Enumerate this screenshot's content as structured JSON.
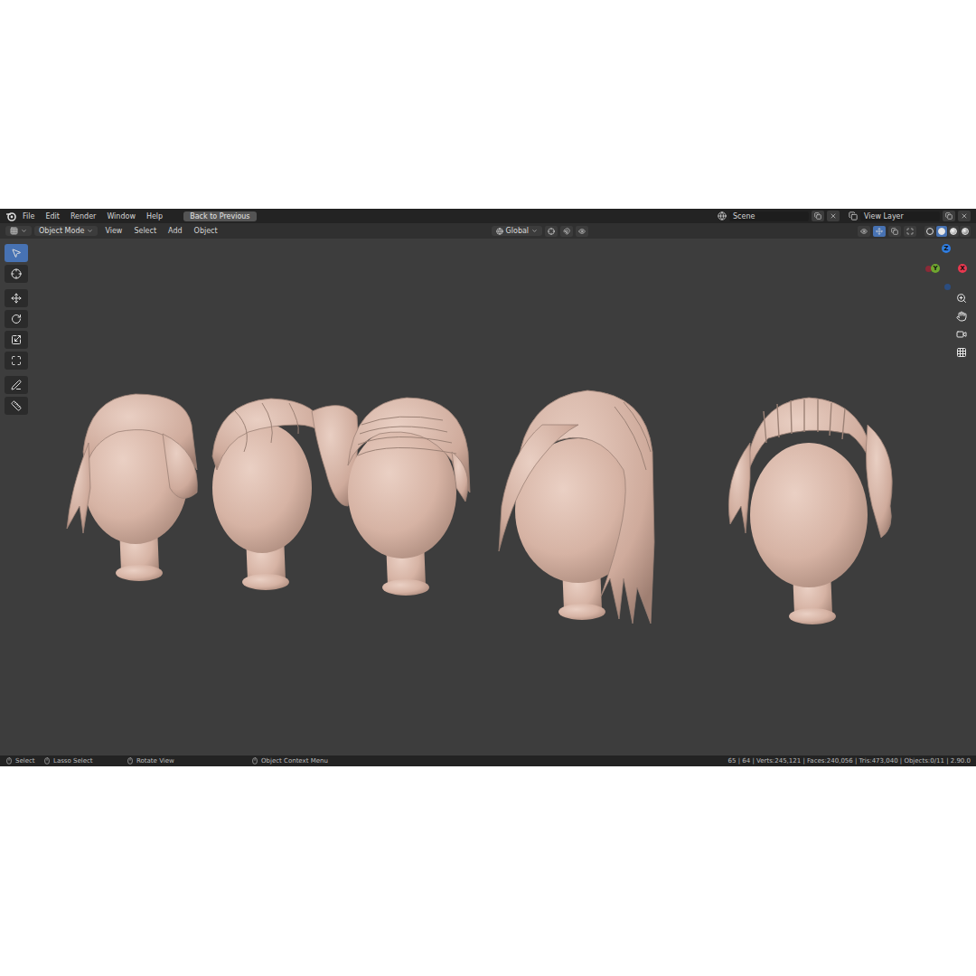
{
  "menu": [
    "File",
    "Edit",
    "Render",
    "Window",
    "Help"
  ],
  "back_button": "Back to Previous",
  "scene": "Scene",
  "view_layer": "View Layer",
  "header": {
    "mode": "Object Mode",
    "menus": [
      "View",
      "Select",
      "Add",
      "Object"
    ],
    "orientation": "Global"
  },
  "tools": [
    {
      "kind": "select",
      "selected": true
    },
    {
      "kind": "cursor",
      "selected": false
    },
    {
      "kind": "move",
      "selected": false
    },
    {
      "kind": "rotate",
      "selected": false
    },
    {
      "kind": "scale",
      "selected": false
    },
    {
      "kind": "transform",
      "selected": false
    },
    {
      "kind": "annotate",
      "selected": false
    },
    {
      "kind": "measure",
      "selected": false
    }
  ],
  "shading": [
    {
      "kind": "wireframe",
      "selected": false
    },
    {
      "kind": "solid",
      "selected": true
    },
    {
      "kind": "material",
      "selected": false
    },
    {
      "kind": "rendered",
      "selected": false
    }
  ],
  "gizmo": {
    "axes": [
      {
        "label": "Z",
        "color": "#2f7de1"
      },
      {
        "label": "Y",
        "color": "#6fa62f"
      },
      {
        "label": "X",
        "color": "#e8384f"
      }
    ]
  },
  "status_bar": {
    "hints": [
      "Select",
      "Lasso Select",
      "Rotate View",
      "Object Context Menu"
    ],
    "stats": "65 | 64 | Verts:245,121 | Faces:240,056 | Tris:473,040 | Objects:0/11 | 2.90.0"
  }
}
